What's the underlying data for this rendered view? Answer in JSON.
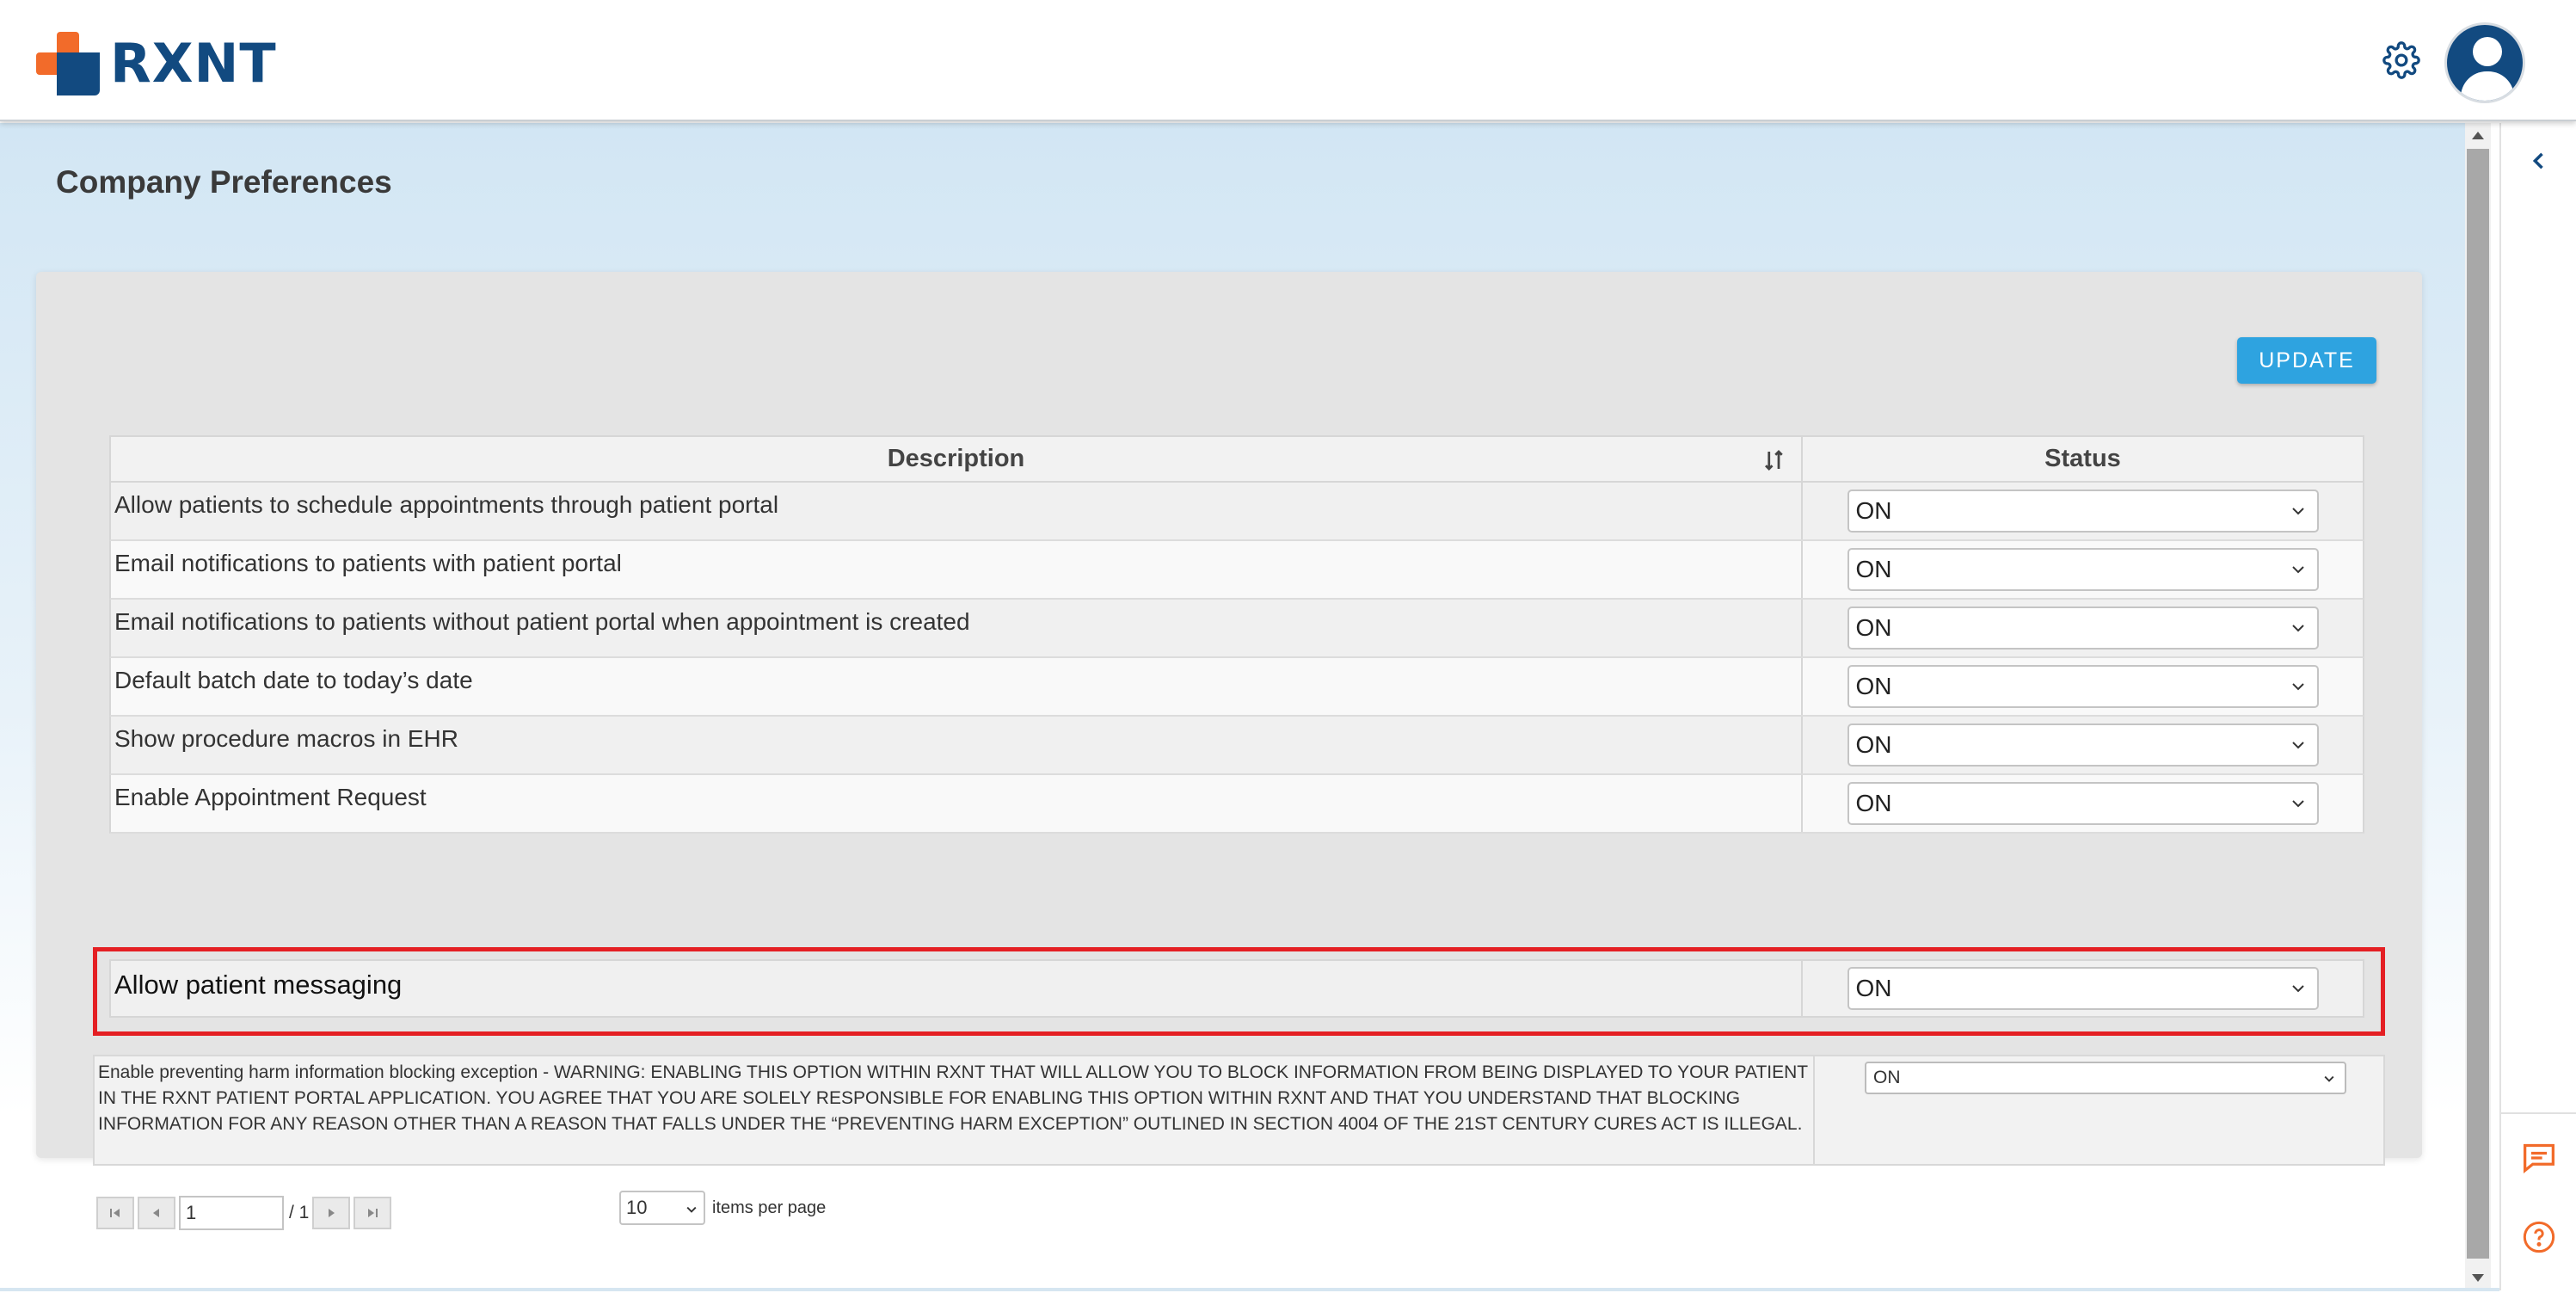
{
  "app": {
    "logo_text": "RXNT"
  },
  "page": {
    "title": "Company Preferences"
  },
  "toolbar": {
    "update_label": "UPDATE"
  },
  "table": {
    "columns": [
      "Description",
      "Status"
    ],
    "rows": [
      {
        "description": "Allow patients to schedule appointments through patient portal",
        "status": "ON"
      },
      {
        "description": "Email notifications to patients with patient portal",
        "status": "ON"
      },
      {
        "description": "Email notifications to patients without patient portal when appointment is created",
        "status": "ON"
      },
      {
        "description": "Default batch date to today’s date",
        "status": "ON"
      },
      {
        "description": "Show procedure macros in EHR",
        "status": "ON"
      },
      {
        "description": "Enable Appointment Request",
        "status": "ON"
      }
    ],
    "highlighted_row": {
      "description": "Allow patient messaging",
      "status": "ON"
    },
    "warning_row": {
      "description": "Enable preventing harm information blocking exception - WARNING: ENABLING THIS OPTION WITHIN RXNT THAT WILL ALLOW YOU TO BLOCK INFORMATION FROM BEING DISPLAYED TO YOUR PATIENT IN THE RXNT PATIENT PORTAL APPLICATION. YOU AGREE THAT YOU ARE SOLELY RESPONSIBLE FOR ENABLING THIS OPTION WITHIN RXNT AND THAT YOU UNDERSTAND THAT BLOCKING INFORMATION FOR ANY REASON OTHER THAN A REASON THAT FALLS UNDER THE “PREVENTING HARM EXCEPTION” OUTLINED IN SECTION 4004 OF THE 21ST CENTURY CURES ACT IS ILLEGAL.",
      "status": "ON"
    }
  },
  "pager": {
    "current_page": "1",
    "total_pages": "/ 1",
    "page_size": "10",
    "items_per_page_label": "items per page"
  },
  "colors": {
    "brand_blue": "#124a80",
    "brand_orange": "#f26b2a",
    "button_blue": "#2ea3e0",
    "highlight_red": "#e41f23"
  },
  "icons": [
    "gear-icon",
    "avatar-icon",
    "sort-icon",
    "chevron-down-icon",
    "first-page-icon",
    "prev-page-icon",
    "next-page-icon",
    "last-page-icon",
    "collapse-chevron-icon",
    "chat-icon",
    "help-icon"
  ]
}
